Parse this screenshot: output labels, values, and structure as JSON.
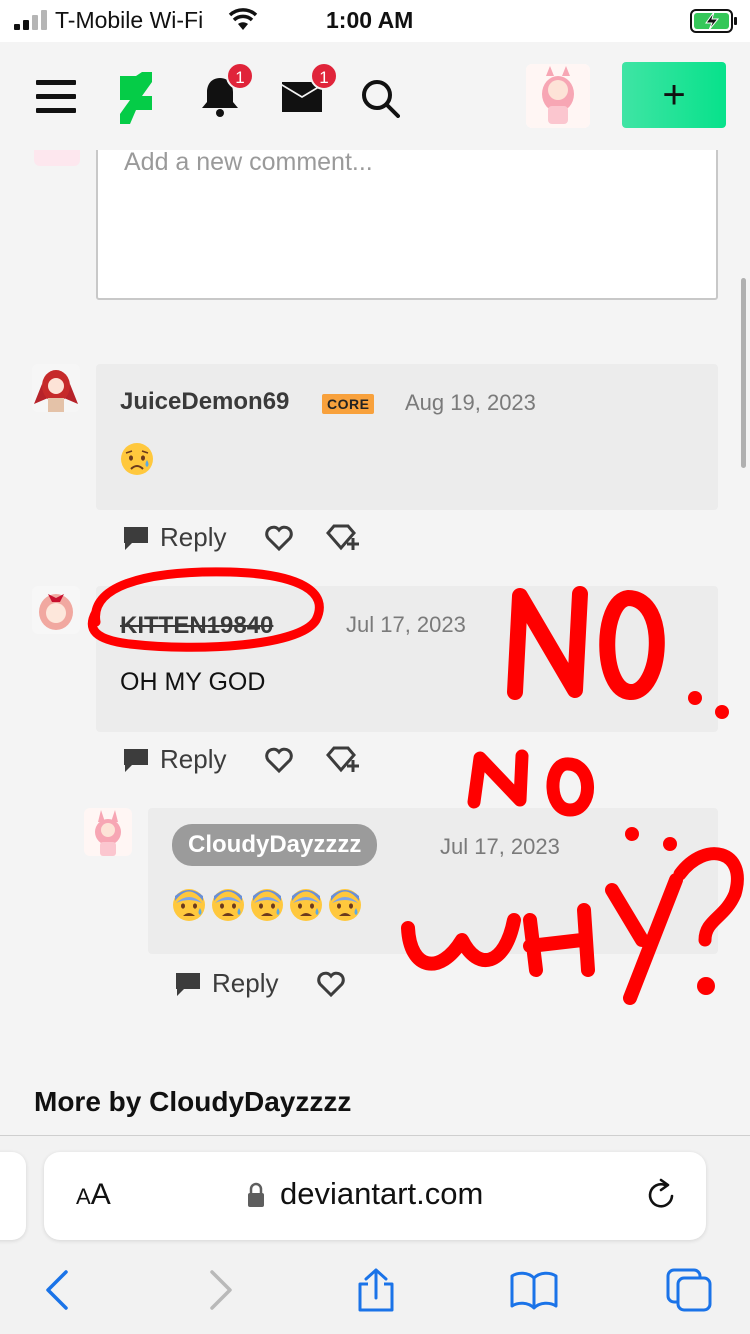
{
  "status_bar": {
    "carrier": "T-Mobile Wi-Fi",
    "time": "1:00 AM"
  },
  "header": {
    "notifications_count": "1",
    "messages_count": "1",
    "submit_label": "+",
    "accent_color": "#07e28b",
    "badge_color": "#e0243a"
  },
  "comment_input": {
    "placeholder": "Add a new comment..."
  },
  "comments": [
    {
      "username": "JuiceDemon69",
      "badge": "CORE",
      "date": "Aug 19, 2023",
      "body_emoji": [
        "sad-relieved-face"
      ],
      "reply_label": "Reply"
    },
    {
      "username": "KITTEN19840",
      "date": "Jul 17, 2023",
      "body": "OH MY GOD",
      "reply_label": "Reply"
    },
    {
      "username": "CloudyDayzzzz",
      "date": "Jul 17, 2023",
      "body_emoji": [
        "anxious-face",
        "anxious-face",
        "anxious-face",
        "anxious-face",
        "anxious-face"
      ],
      "reply_label": "Reply"
    }
  ],
  "annotations": {
    "color": "#ff0000",
    "text1": "NO..",
    "text2": "No..",
    "text3": "WHY?"
  },
  "more_section": {
    "title": "More by CloudyDayzzzz"
  },
  "safari": {
    "text_size_small": "A",
    "text_size_big": "A",
    "url": "deviantart.com"
  }
}
